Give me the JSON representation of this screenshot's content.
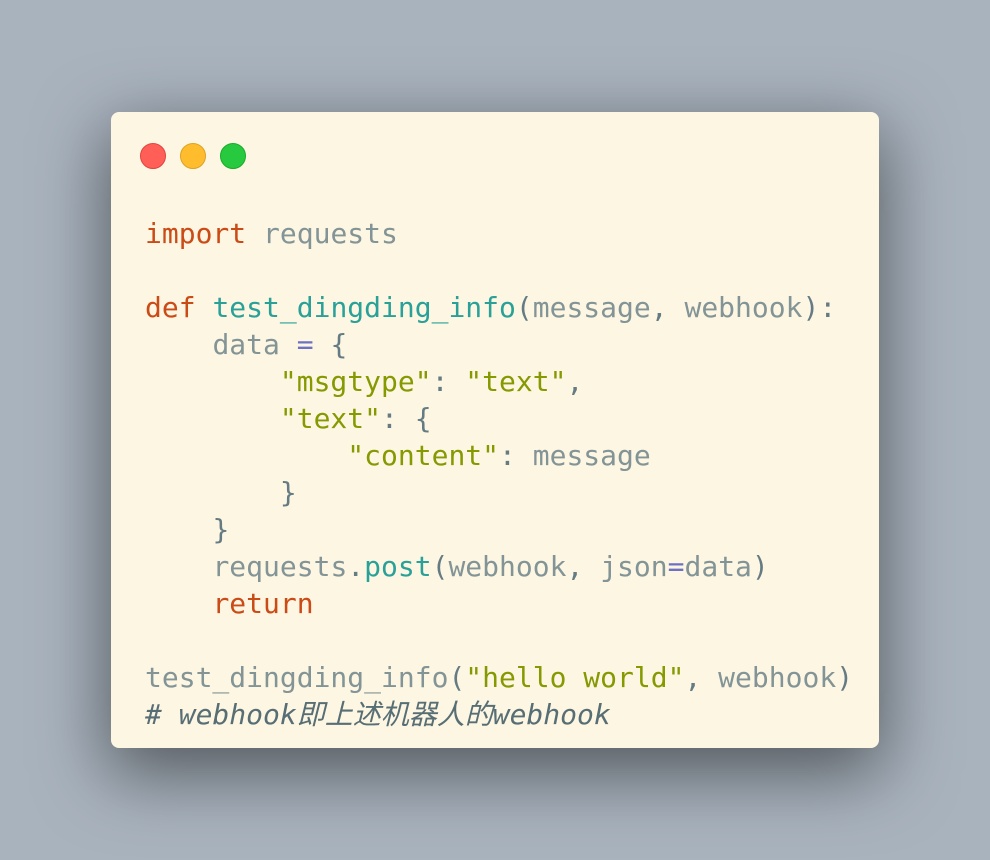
{
  "colors": {
    "background": "#a9b3be",
    "editor_background": "#fdf6e3",
    "keyword": "#cb4b16",
    "function": "#2aa198",
    "string": "#859900",
    "operator": "#6c71c4",
    "identifier": "#839496",
    "punctuation": "#657b83",
    "comment": "#586e75"
  },
  "window_controls": [
    "close",
    "minimize",
    "maximize"
  ],
  "code": {
    "language": "python",
    "line1": {
      "kw": "import",
      "mod": "requests"
    },
    "line3": {
      "kw": "def",
      "fn": "test_dingding_info",
      "p1": "message",
      "p2": "webhook"
    },
    "line4": {
      "var": "data"
    },
    "line5": {
      "key": "\"msgtype\"",
      "val": "\"text\""
    },
    "line6": {
      "key": "\"text\""
    },
    "line7": {
      "key": "\"content\"",
      "val": "message"
    },
    "line10": {
      "obj": "requests",
      "method": "post",
      "arg1": "webhook",
      "kwarg": "json",
      "kwval": "data"
    },
    "line11": {
      "kw": "return"
    },
    "line13": {
      "fn": "test_dingding_info",
      "arg1": "\"hello world\"",
      "arg2": "webhook"
    },
    "line14": {
      "comment": "# webhook即上述机器人的webhook"
    }
  }
}
